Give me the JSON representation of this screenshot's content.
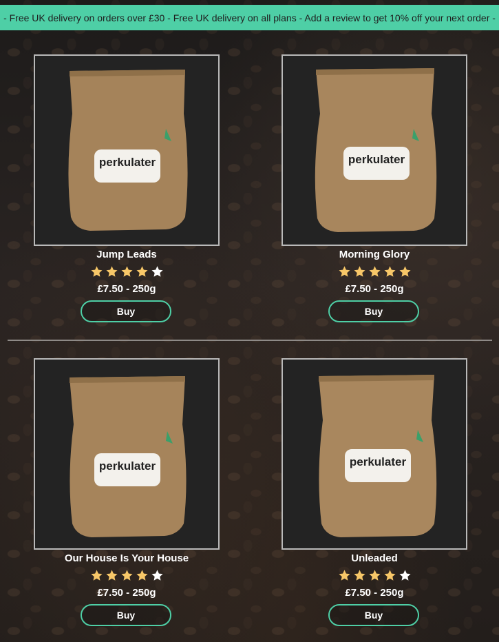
{
  "banner": {
    "text": "- Free UK delivery on orders over £30 - Free UK delivery on all plans - Add a review to get 10% off your next order -",
    "color": "#4ecfa6"
  },
  "products": [
    {
      "name": "Jump Leads",
      "rating": 4,
      "price": "£7.50 - 250g",
      "buy_label": "Buy",
      "bag_label": "perkulater"
    },
    {
      "name": "Morning Glory",
      "rating": 5,
      "price": "£7.50 - 250g",
      "buy_label": "Buy",
      "bag_label": "perkulater"
    },
    {
      "name": "Our House Is Your House",
      "rating": 4,
      "price": "£7.50 - 250g",
      "buy_label": "Buy",
      "bag_label": "perkulater"
    },
    {
      "name": "Unleaded",
      "rating": 4,
      "price": "£7.50 - 250g",
      "buy_label": "Buy",
      "bag_label": "perkulater"
    }
  ],
  "colors": {
    "star_filled": "#f7c768",
    "star_empty": "#ffffff",
    "accent": "#4ecfa6"
  }
}
